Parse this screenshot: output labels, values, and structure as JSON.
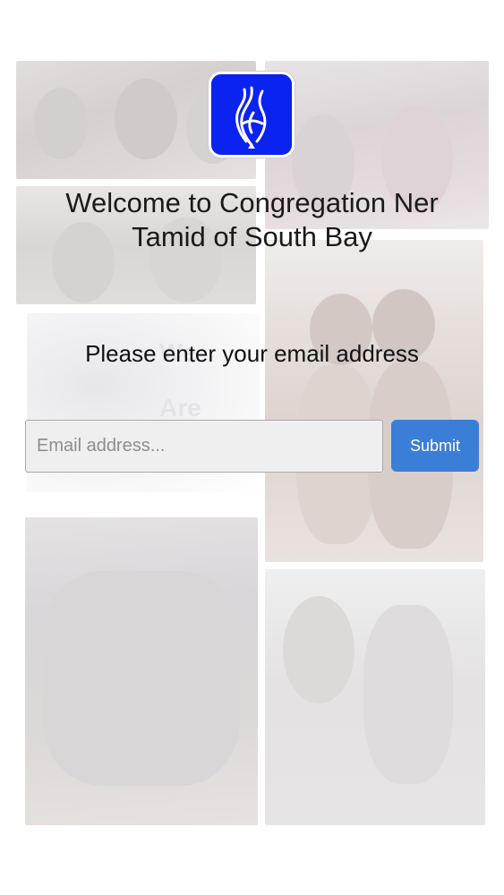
{
  "logo": {
    "icon": "flame-menorah-icon",
    "background_color": "#0a23f0"
  },
  "welcome": {
    "line1": "Welcome to Congregation Ner",
    "line2": "Tamid of South Bay"
  },
  "prompt": {
    "text": "Please enter your email address"
  },
  "email": {
    "placeholder": "Email address...",
    "value": ""
  },
  "submit": {
    "label": "Submit",
    "color": "#3a7ed8"
  },
  "background": {
    "watermark_words": [
      "We",
      "Are"
    ]
  }
}
